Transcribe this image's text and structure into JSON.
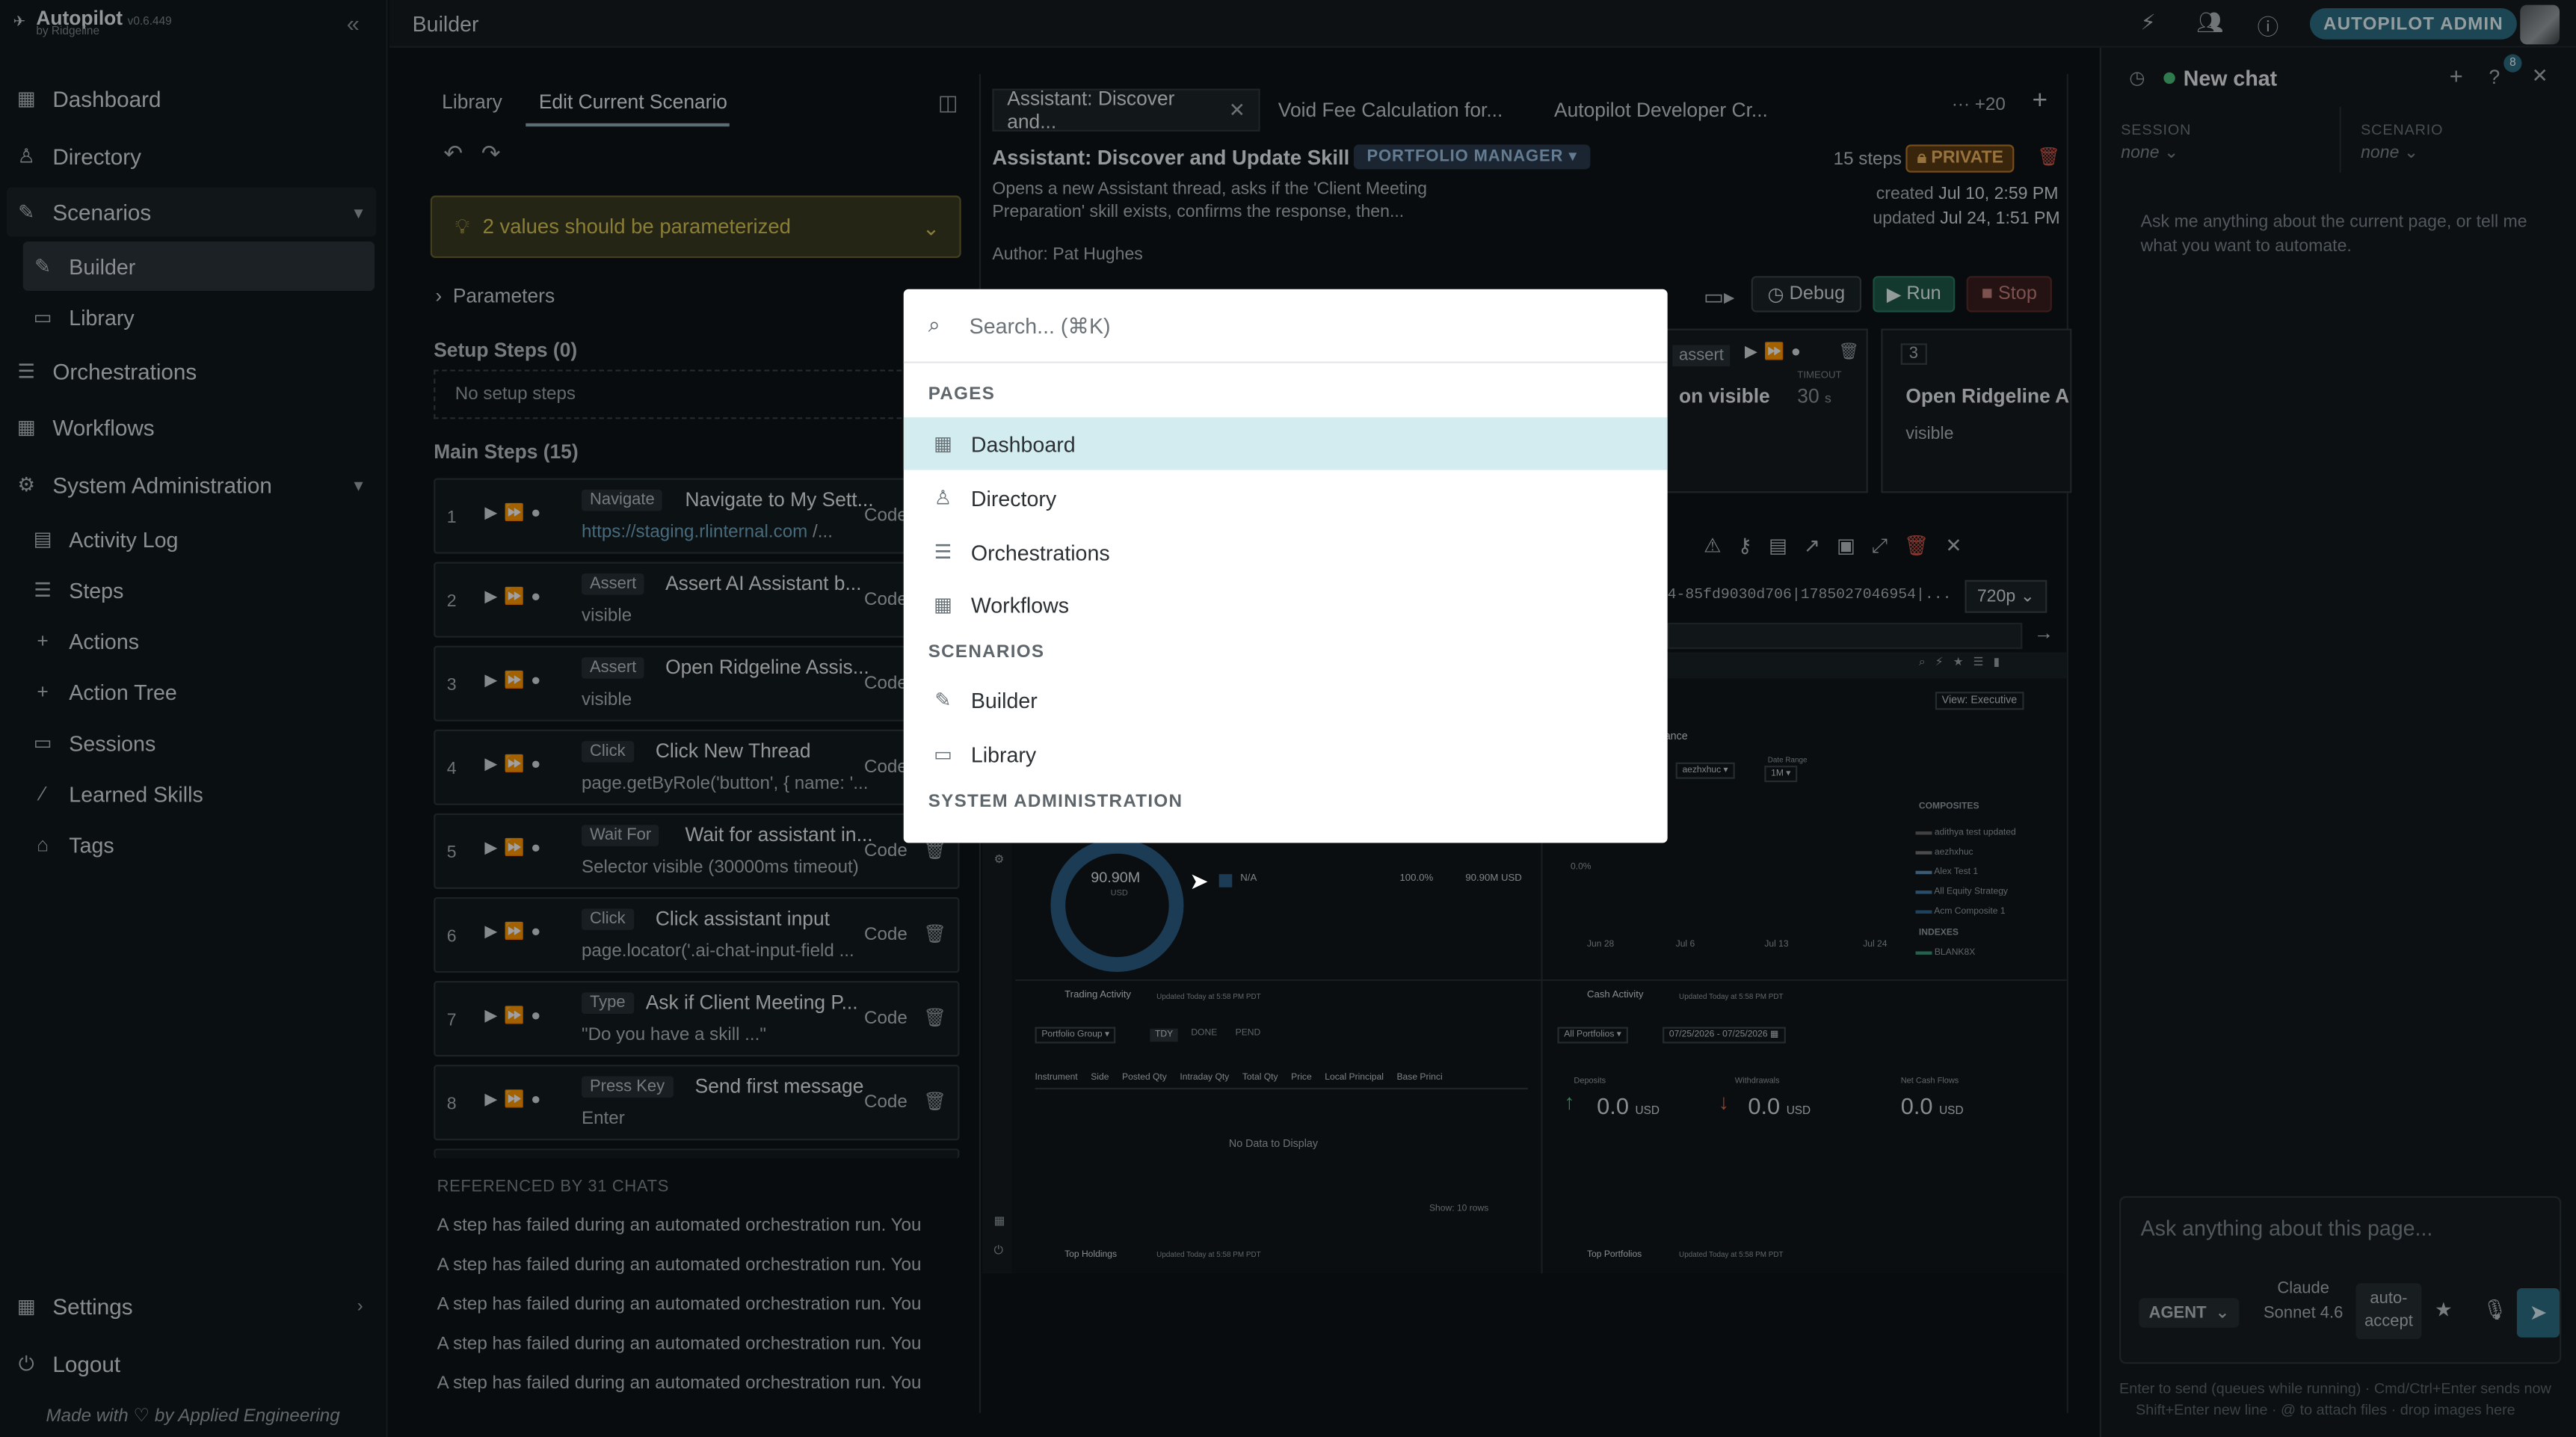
{
  "app": {
    "name": "Autopilot",
    "version": "v0.6.449",
    "by": "by Ridgeline",
    "made_with": "Made with",
    "made_by": "by Applied Engineering"
  },
  "header": {
    "title": "Builder",
    "role_badge": "AUTOPILOT ADMIN"
  },
  "sidebar": {
    "items": [
      {
        "label": "Dashboard",
        "icon": "grid-icon"
      },
      {
        "label": "Directory",
        "icon": "person-icon"
      },
      {
        "label": "Scenarios",
        "icon": "wrench-icon"
      },
      {
        "label": "Builder",
        "icon": "wrench-icon"
      },
      {
        "label": "Library",
        "icon": "book-icon"
      },
      {
        "label": "Orchestrations",
        "icon": "list-icon"
      },
      {
        "label": "Workflows",
        "icon": "grid-icon"
      },
      {
        "label": "System Administration",
        "icon": "gear-icon"
      },
      {
        "label": "Activity Log",
        "icon": "log-icon"
      },
      {
        "label": "Steps",
        "icon": "list-icon"
      },
      {
        "label": "Actions",
        "icon": "plus-icon"
      },
      {
        "label": "Action Tree",
        "icon": "plus-icon"
      },
      {
        "label": "Sessions",
        "icon": "monitor-icon"
      },
      {
        "label": "Learned Skills",
        "icon": "wand-icon"
      },
      {
        "label": "Tags",
        "icon": "tag-icon"
      }
    ],
    "settings": "Settings",
    "logout": "Logout"
  },
  "editor": {
    "tabs": [
      "Library",
      "Edit Current Scenario"
    ],
    "warning": "2 values should be parameterized",
    "parameters": "Parameters",
    "setup_steps": "Setup Steps (0)",
    "no_setup": "No setup steps",
    "main_steps": "Main Steps (15)",
    "code_label": "Code",
    "steps": [
      {
        "num": "1",
        "type": "Navigate",
        "title": "Navigate to My Sett...",
        "desc_url": "https://staging.rlinternal.com",
        "desc": " /..."
      },
      {
        "num": "2",
        "type": "Assert",
        "title": "Assert AI Assistant b...",
        "desc": "visible"
      },
      {
        "num": "3",
        "type": "Assert",
        "title": "Open Ridgeline Assis...",
        "desc": "visible"
      },
      {
        "num": "4",
        "type": "Click",
        "title": "Click New Thread",
        "desc": "page.getByRole('button', { name: '..."
      },
      {
        "num": "5",
        "type": "Wait For",
        "title": "Wait for assistant in...",
        "desc": "Selector visible (30000ms timeout)"
      },
      {
        "num": "6",
        "type": "Click",
        "title": "Click assistant input",
        "desc": "page.locator('.ai-chat-input-field ..."
      },
      {
        "num": "7",
        "type": "Type",
        "title": "Ask if Client Meeting P...",
        "desc": "\"Do you have a skill ...\""
      },
      {
        "num": "8",
        "type": "Press Key",
        "title": "Send first message",
        "desc": "Enter"
      }
    ],
    "referenced": "REFERENCED BY 31 CHATS",
    "refs": [
      "A step has failed during an automated orchestration run. You",
      "A step has failed during an automated orchestration run. You",
      "A step has failed during an automated orchestration run. You",
      "A step has failed during an automated orchestration run. You",
      "A step has failed during an automated orchestration run. You"
    ]
  },
  "scenario": {
    "tabs": [
      "Assistant: Discover and...",
      "Void Fee Calculation for...",
      "Autopilot Developer Cr..."
    ],
    "more_tabs": "+20",
    "title": "Assistant: Discover and Update Skill",
    "role": "PORTFOLIO MANAGER",
    "steps_count": "15 steps",
    "private": "PRIVATE",
    "desc1": "Opens a new Assistant thread, asks if the 'Client Meeting",
    "desc2": "Preparation' skill exists, confirms the response, then...",
    "created_label": "created",
    "created": "Jul 10, 2:59 PM",
    "updated_label": "updated",
    "updated": "Jul 24, 1:51 PM",
    "author_label": "Author:",
    "author": "Pat Hughes",
    "debug": "Debug",
    "run": "Run",
    "stop": "Stop",
    "card_assert": "assert",
    "card_visible_frag": "on visible",
    "timeout_label": "TIMEOUT",
    "timeout": "30",
    "timeout_unit": "s",
    "card3_num": "3",
    "card3_title": "Open Ridgeline As",
    "card3_desc": "visible",
    "session_id": "4-85fd9030d706|1785027046954|...",
    "resolution": "720p"
  },
  "dashboard": {
    "view": "View: Executive",
    "donut_value": "90.90M",
    "donut_unit": "USD",
    "na": "N/A",
    "pct": "100.0%",
    "amt": "90.90M USD",
    "trading": "Trading Activity",
    "cash": "Cash Activity",
    "updated": "Updated Today at 5:58 PM PDT",
    "portfolio_group": "Portfolio Group",
    "seg": [
      "TDY",
      "DONE",
      "PEND"
    ],
    "cols": [
      "Instrument",
      "Side",
      "Posted Qty",
      "Intraday Qty",
      "Total Qty",
      "Price",
      "Local Principal",
      "Base Princi"
    ],
    "no_data": "No Data to Display",
    "show": "Show: 10 rows",
    "all_portfolios": "All Portfolios",
    "date_range": "07/25/2026 - 07/25/2026",
    "deposits": "Deposits",
    "withdrawals": "Withdrawals",
    "net": "Net Cash Flows",
    "zero": "0.0",
    "usd": "USD",
    "top_holdings": "Top Holdings",
    "top_portfolios": "Top Portfolios",
    "composites": "COMPOSITES",
    "composite_items": [
      "adithya test updated",
      "aezhxhuc",
      "Alex Test 1",
      "All Equity Strategy",
      "Acm Composite 1"
    ],
    "indexes": "INDEXES",
    "index_item": "BLANK8X",
    "perf": "ormance",
    "date_range_lbl": "Date Range",
    "one_m": "1M",
    "xticks": [
      "Jun 28",
      "Jul 6",
      "Jul 13",
      "Jul 24"
    ],
    "pct_tick": "0.0%"
  },
  "chat": {
    "title": "New chat",
    "help_badge": "8",
    "session_label": "SESSION",
    "session_val": "none",
    "scenario_label": "SCENARIO",
    "scenario_val": "none",
    "intro": "Ask me anything about the current page, or tell me what you want to automate.",
    "input_placeholder": "Ask anything about this page...",
    "agent": "AGENT",
    "model": "Claude Sonnet 4.6",
    "auto_accept": "auto-accept",
    "hint1": "Enter to send (queues while running) · Cmd/Ctrl+Enter sends now",
    "hint2": "Shift+Enter new line · @ to attach files · drop images here"
  },
  "palette": {
    "placeholder": "Search... (⌘K)",
    "sections": [
      {
        "title": "PAGES",
        "items": [
          {
            "label": "Dashboard",
            "icon": "grid-icon"
          },
          {
            "label": "Directory",
            "icon": "person-icon"
          },
          {
            "label": "Orchestrations",
            "icon": "list-icon"
          },
          {
            "label": "Workflows",
            "icon": "grid-icon"
          }
        ]
      },
      {
        "title": "SCENARIOS",
        "items": [
          {
            "label": "Builder",
            "icon": "wrench-icon"
          },
          {
            "label": "Library",
            "icon": "book-icon"
          }
        ]
      },
      {
        "title": "SYSTEM ADMINISTRATION",
        "items": []
      }
    ]
  }
}
